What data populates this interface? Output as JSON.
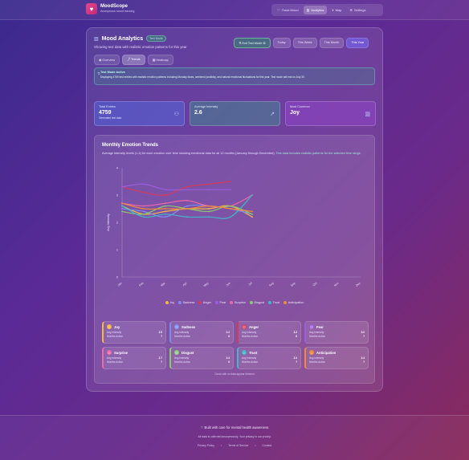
{
  "brand": {
    "name": "MoodScope",
    "tagline": "Anonymous mood tracking"
  },
  "topnav": [
    {
      "label": "Track Mood",
      "icon": "heart-icon"
    },
    {
      "label": "Analytics",
      "icon": "bar-chart-icon",
      "active": true
    },
    {
      "label": "Map",
      "icon": "map-pin-icon"
    },
    {
      "label": "Settings",
      "icon": "gear-icon"
    }
  ],
  "header": {
    "title": "Mood Analytics",
    "badge": "Test Mode",
    "subtitle": "Showing test data with realistic emotion patterns for this year"
  },
  "view_tabs": [
    {
      "label": "Overview",
      "icon": "eye-icon"
    },
    {
      "label": "Trends",
      "icon": "trend-icon",
      "active": true
    },
    {
      "label": "Heatmap",
      "icon": "grid-icon"
    }
  ],
  "range_buttons": [
    {
      "label": "Exit Test Mode",
      "variant": "exit"
    },
    {
      "label": "Today"
    },
    {
      "label": "This Week"
    },
    {
      "label": "This Month"
    },
    {
      "label": "This Year",
      "active": true
    }
  ],
  "notice": {
    "title": "Test Mode Active",
    "body": "Displaying 4759 test entries with realistic emotion patterns including Monday blues, weekend positivity, and natural emotional fluctuations for this year. Test mode will end on July 30."
  },
  "stats": [
    {
      "label": "Total Entries",
      "value": "4759",
      "sub": "Generated test data",
      "icon": "users-icon"
    },
    {
      "label": "Average Intensity",
      "value": "2.6",
      "sub": "",
      "icon": "trend-up-icon"
    },
    {
      "label": "Most Common",
      "value": "Joy",
      "sub": "",
      "icon": "bar-chart-icon"
    }
  ],
  "trends": {
    "title": "Monthly Emotion Trends",
    "desc_plain": "Average intensity levels (1-4) for each emotion over time showing emotional data for all 12 months (January through December). ",
    "desc_highlight": "Test data includes realistic patterns for the selected time range."
  },
  "chart_data": {
    "type": "line",
    "ylabel": "Avg Intensity",
    "ylim": [
      0,
      4
    ],
    "yticks": [
      0,
      1,
      2,
      3,
      4
    ],
    "categories": [
      "Jan",
      "Feb",
      "Mar",
      "Apr",
      "May",
      "Jun",
      "Jul",
      "Aug",
      "Sep",
      "Oct",
      "Nov",
      "Dec"
    ],
    "series": [
      {
        "name": "Joy",
        "color": "#f5b942",
        "values": [
          2.6,
          2.3,
          2.4,
          2.5,
          2.5,
          2.6,
          2.2,
          null,
          null,
          null,
          null,
          null
        ]
      },
      {
        "name": "Sadness",
        "color": "#7b8cf0",
        "values": [
          2.5,
          2.4,
          2.2,
          2.6,
          2.6,
          2.5,
          2.3,
          null,
          null,
          null,
          null,
          null
        ]
      },
      {
        "name": "Anger",
        "color": "#d63a5a",
        "values": [
          3.3,
          3.1,
          3.0,
          3.3,
          3.4,
          3.5,
          null,
          null,
          null,
          null,
          null,
          null
        ]
      },
      {
        "name": "Fear",
        "color": "#9b5ce0",
        "values": [
          3.3,
          3.4,
          3.2,
          3.2,
          3.2,
          3.2,
          null,
          null,
          null,
          null,
          null,
          null
        ]
      },
      {
        "name": "Surprise",
        "color": "#ec6aa8",
        "values": [
          2.7,
          2.6,
          2.7,
          2.8,
          2.6,
          2.6,
          3.0,
          null,
          null,
          null,
          null,
          null
        ]
      },
      {
        "name": "Disgust",
        "color": "#8ac96a",
        "values": [
          2.4,
          2.3,
          2.6,
          2.5,
          2.4,
          2.6,
          2.3,
          null,
          null,
          null,
          null,
          null
        ]
      },
      {
        "name": "Trust",
        "color": "#3fb8c8",
        "values": [
          2.6,
          2.2,
          2.3,
          2.2,
          2.2,
          2.2,
          3.0,
          null,
          null,
          null,
          null,
          null
        ]
      },
      {
        "name": "Anticipation",
        "color": "#f08a3a",
        "values": [
          2.7,
          2.5,
          2.5,
          2.5,
          2.6,
          2.5,
          2.4,
          null,
          null,
          null,
          null,
          null
        ]
      }
    ]
  },
  "emotion_cards": [
    {
      "name": "Joy",
      "emoji": "☺",
      "color": "#f5b942",
      "intensity": "2.5",
      "active": "7"
    },
    {
      "name": "Sadness",
      "emoji": "☹",
      "color": "#7b8cf0",
      "intensity": "2.2",
      "active": "6"
    },
    {
      "name": "Anger",
      "emoji": "☹",
      "color": "#d63a5a",
      "intensity": "3.2",
      "active": "6"
    },
    {
      "name": "Fear",
      "emoji": "☹",
      "color": "#9b5ce0",
      "intensity": "3.0",
      "active": "7"
    },
    {
      "name": "Surprise",
      "emoji": "☺",
      "color": "#ec6aa8",
      "intensity": "2.7",
      "active": "7"
    },
    {
      "name": "Disgust",
      "emoji": "☹",
      "color": "#8ac96a",
      "intensity": "2.4",
      "active": "6"
    },
    {
      "name": "Trust",
      "emoji": "☺",
      "color": "#3fb8c8",
      "intensity": "2.4",
      "active": "7"
    },
    {
      "name": "Anticipation",
      "emoji": "☺",
      "color": "#f08a3a",
      "intensity": "2.4",
      "active": "7"
    }
  ],
  "card_labels": {
    "intensity": "Avg Intensity",
    "active": "Months Active"
  },
  "cards_note": "Cards with no data appear dimmed",
  "footer": {
    "built": "Built with care for mental health awareness",
    "privacy": "All data is collected anonymously. Your privacy is our priority.",
    "links": [
      "Privacy Policy",
      "Terms of Service",
      "Contact"
    ]
  }
}
